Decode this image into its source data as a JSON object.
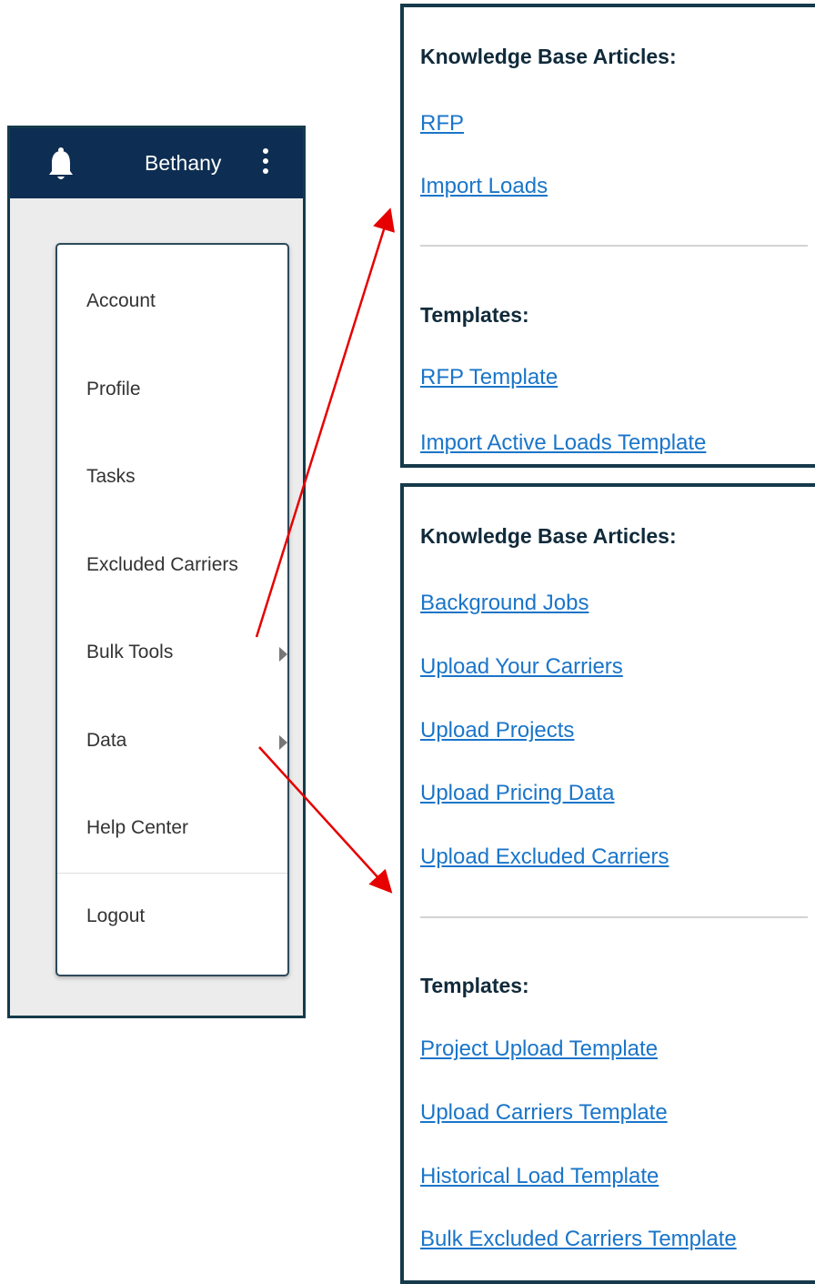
{
  "header": {
    "username": "Bethany",
    "icons": [
      "bell-icon",
      "kebab-menu-icon"
    ]
  },
  "menu": {
    "items": [
      {
        "label": "Account",
        "has_submenu": false
      },
      {
        "label": "Profile",
        "has_submenu": false
      },
      {
        "label": "Tasks",
        "has_submenu": false
      },
      {
        "label": "Excluded Carriers",
        "has_submenu": false
      },
      {
        "label": "Bulk Tools",
        "has_submenu": true
      },
      {
        "label": "Data",
        "has_submenu": true
      },
      {
        "label": "Help Center",
        "has_submenu": false
      },
      {
        "label": "Logout",
        "has_submenu": false
      }
    ]
  },
  "bulk_tools_panel": {
    "kb_heading": "Knowledge Base Articles:",
    "kb_links": [
      "RFP",
      "Import Loads"
    ],
    "templates_heading": "Templates:",
    "template_links": [
      "RFP Template",
      "Import Active Loads Template"
    ]
  },
  "data_panel": {
    "kb_heading": "Knowledge Base Articles:",
    "kb_links": [
      "Background Jobs",
      "Upload Your Carriers",
      "Upload Projects",
      "Upload Pricing Data",
      "Upload Excluded Carriers"
    ],
    "templates_heading": "Templates:",
    "template_links": [
      "Project Upload Template",
      "Upload Carriers Template",
      "Historical Load Template",
      "Bulk Excluded Carriers Template"
    ]
  },
  "colors": {
    "topbar": "#0d2e52",
    "frame_border": "#153a4b",
    "link": "#1a75c9",
    "arrow": "#e60000"
  }
}
